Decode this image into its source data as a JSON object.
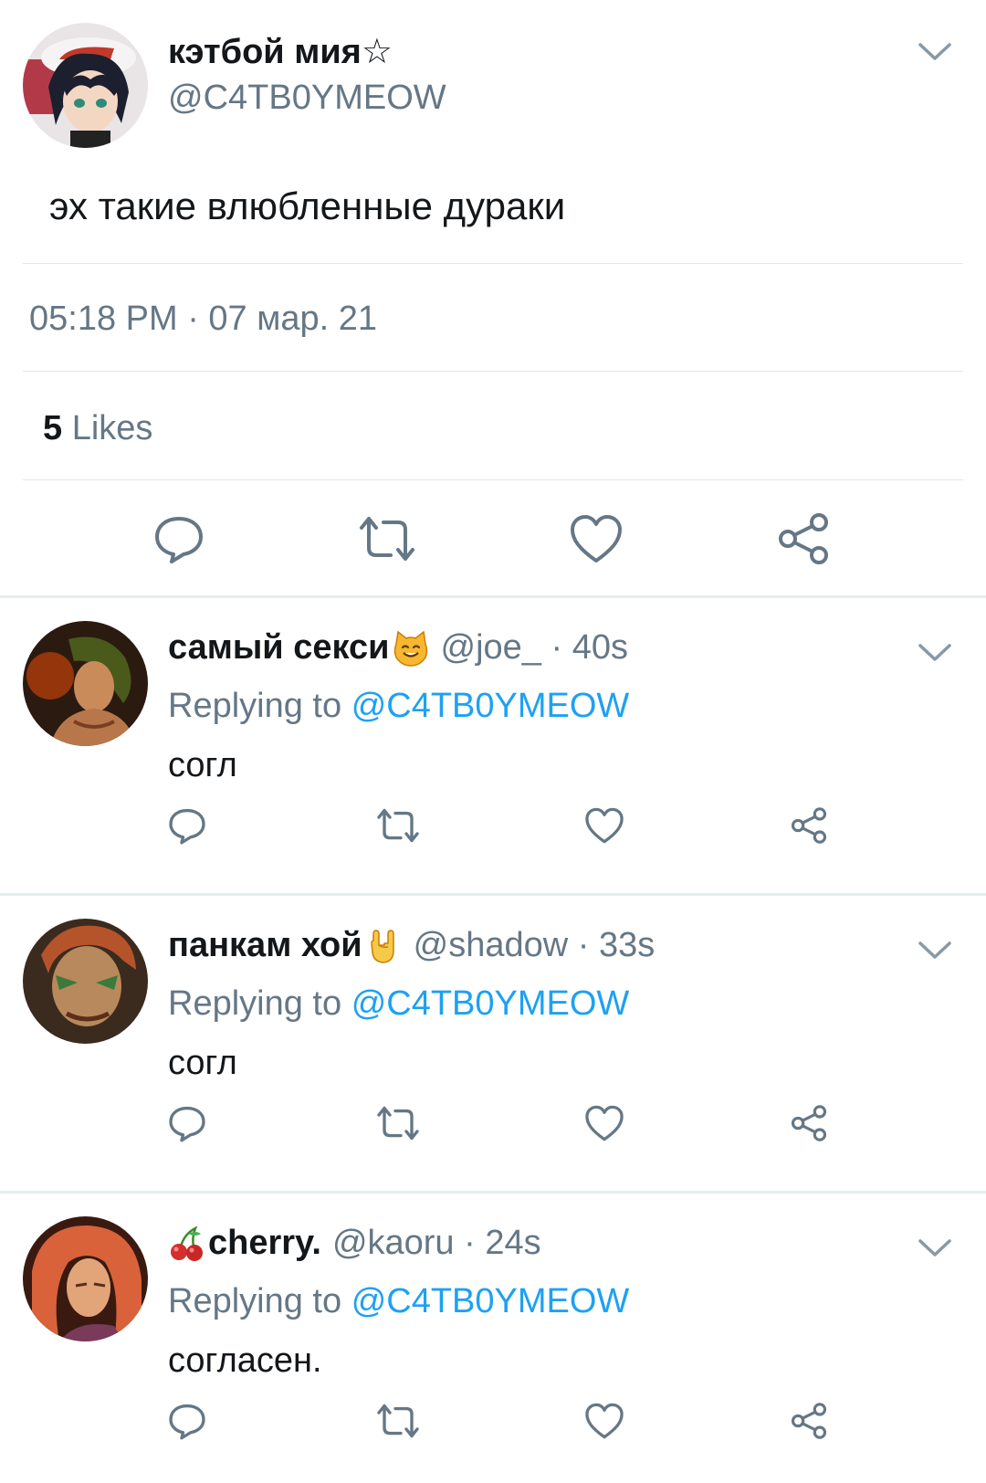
{
  "main_tweet": {
    "display_name": "кэтбой мия☆",
    "handle": "@C4TB0YMEOW",
    "text": "эх такие влюбленные дураки",
    "timestamp": "05:18 PM · 07 мар. 21",
    "likes_count": "5",
    "likes_label": "Likes"
  },
  "replies": [
    {
      "display_name": "самый секси",
      "emoji": "cat-face-emoji",
      "meta": "@joe_ · 40s",
      "replying_prefix": "Replying to",
      "replying_mention": "@C4TB0YMEOW",
      "text": "согл"
    },
    {
      "display_name": "панкам хой",
      "emoji": "rock-on-hand-emoji",
      "meta": "@shadow · 33s",
      "replying_prefix": "Replying to",
      "replying_mention": "@C4TB0YMEOW",
      "text": "согл"
    },
    {
      "display_name": "cherry.",
      "emoji": "cherries-emoji",
      "meta": "@kaoru · 24s",
      "replying_prefix": "Replying to",
      "replying_mention": "@C4TB0YMEOW",
      "text": "согласен."
    }
  ],
  "colors": {
    "text_primary": "#14171a",
    "text_secondary": "#657786",
    "accent_blue": "#1da1f2",
    "divider": "#e1e8ed",
    "icon_gray": "#657786"
  }
}
